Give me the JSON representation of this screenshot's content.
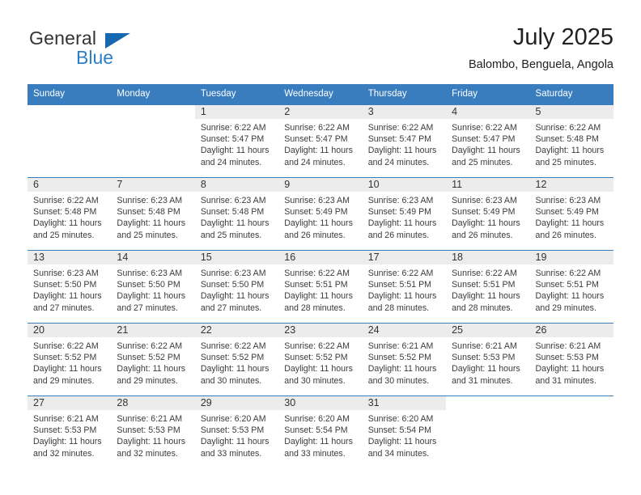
{
  "brand": {
    "name_part1": "General",
    "name_part2": "Blue",
    "triangle_color": "#1668b3",
    "blue_color": "#2a7fc9"
  },
  "header": {
    "title": "July 2025",
    "subtitle": "Balombo, Benguela, Angola"
  },
  "colors": {
    "header_row": "#3a7dbf",
    "daynum_strip": "#ececec",
    "row_separator": "#3a7dbf",
    "text": "#3b3b3b"
  },
  "weekday_headers": [
    "Sunday",
    "Monday",
    "Tuesday",
    "Wednesday",
    "Thursday",
    "Friday",
    "Saturday"
  ],
  "weeks": [
    [
      {
        "day": "",
        "sunrise": "",
        "sunset": "",
        "daylight": ""
      },
      {
        "day": "",
        "sunrise": "",
        "sunset": "",
        "daylight": ""
      },
      {
        "day": "1",
        "sunrise": "Sunrise: 6:22 AM",
        "sunset": "Sunset: 5:47 PM",
        "daylight": "Daylight: 11 hours and 24 minutes."
      },
      {
        "day": "2",
        "sunrise": "Sunrise: 6:22 AM",
        "sunset": "Sunset: 5:47 PM",
        "daylight": "Daylight: 11 hours and 24 minutes."
      },
      {
        "day": "3",
        "sunrise": "Sunrise: 6:22 AM",
        "sunset": "Sunset: 5:47 PM",
        "daylight": "Daylight: 11 hours and 24 minutes."
      },
      {
        "day": "4",
        "sunrise": "Sunrise: 6:22 AM",
        "sunset": "Sunset: 5:47 PM",
        "daylight": "Daylight: 11 hours and 25 minutes."
      },
      {
        "day": "5",
        "sunrise": "Sunrise: 6:22 AM",
        "sunset": "Sunset: 5:48 PM",
        "daylight": "Daylight: 11 hours and 25 minutes."
      }
    ],
    [
      {
        "day": "6",
        "sunrise": "Sunrise: 6:22 AM",
        "sunset": "Sunset: 5:48 PM",
        "daylight": "Daylight: 11 hours and 25 minutes."
      },
      {
        "day": "7",
        "sunrise": "Sunrise: 6:23 AM",
        "sunset": "Sunset: 5:48 PM",
        "daylight": "Daylight: 11 hours and 25 minutes."
      },
      {
        "day": "8",
        "sunrise": "Sunrise: 6:23 AM",
        "sunset": "Sunset: 5:48 PM",
        "daylight": "Daylight: 11 hours and 25 minutes."
      },
      {
        "day": "9",
        "sunrise": "Sunrise: 6:23 AM",
        "sunset": "Sunset: 5:49 PM",
        "daylight": "Daylight: 11 hours and 26 minutes."
      },
      {
        "day": "10",
        "sunrise": "Sunrise: 6:23 AM",
        "sunset": "Sunset: 5:49 PM",
        "daylight": "Daylight: 11 hours and 26 minutes."
      },
      {
        "day": "11",
        "sunrise": "Sunrise: 6:23 AM",
        "sunset": "Sunset: 5:49 PM",
        "daylight": "Daylight: 11 hours and 26 minutes."
      },
      {
        "day": "12",
        "sunrise": "Sunrise: 6:23 AM",
        "sunset": "Sunset: 5:49 PM",
        "daylight": "Daylight: 11 hours and 26 minutes."
      }
    ],
    [
      {
        "day": "13",
        "sunrise": "Sunrise: 6:23 AM",
        "sunset": "Sunset: 5:50 PM",
        "daylight": "Daylight: 11 hours and 27 minutes."
      },
      {
        "day": "14",
        "sunrise": "Sunrise: 6:23 AM",
        "sunset": "Sunset: 5:50 PM",
        "daylight": "Daylight: 11 hours and 27 minutes."
      },
      {
        "day": "15",
        "sunrise": "Sunrise: 6:23 AM",
        "sunset": "Sunset: 5:50 PM",
        "daylight": "Daylight: 11 hours and 27 minutes."
      },
      {
        "day": "16",
        "sunrise": "Sunrise: 6:22 AM",
        "sunset": "Sunset: 5:51 PM",
        "daylight": "Daylight: 11 hours and 28 minutes."
      },
      {
        "day": "17",
        "sunrise": "Sunrise: 6:22 AM",
        "sunset": "Sunset: 5:51 PM",
        "daylight": "Daylight: 11 hours and 28 minutes."
      },
      {
        "day": "18",
        "sunrise": "Sunrise: 6:22 AM",
        "sunset": "Sunset: 5:51 PM",
        "daylight": "Daylight: 11 hours and 28 minutes."
      },
      {
        "day": "19",
        "sunrise": "Sunrise: 6:22 AM",
        "sunset": "Sunset: 5:51 PM",
        "daylight": "Daylight: 11 hours and 29 minutes."
      }
    ],
    [
      {
        "day": "20",
        "sunrise": "Sunrise: 6:22 AM",
        "sunset": "Sunset: 5:52 PM",
        "daylight": "Daylight: 11 hours and 29 minutes."
      },
      {
        "day": "21",
        "sunrise": "Sunrise: 6:22 AM",
        "sunset": "Sunset: 5:52 PM",
        "daylight": "Daylight: 11 hours and 29 minutes."
      },
      {
        "day": "22",
        "sunrise": "Sunrise: 6:22 AM",
        "sunset": "Sunset: 5:52 PM",
        "daylight": "Daylight: 11 hours and 30 minutes."
      },
      {
        "day": "23",
        "sunrise": "Sunrise: 6:22 AM",
        "sunset": "Sunset: 5:52 PM",
        "daylight": "Daylight: 11 hours and 30 minutes."
      },
      {
        "day": "24",
        "sunrise": "Sunrise: 6:21 AM",
        "sunset": "Sunset: 5:52 PM",
        "daylight": "Daylight: 11 hours and 30 minutes."
      },
      {
        "day": "25",
        "sunrise": "Sunrise: 6:21 AM",
        "sunset": "Sunset: 5:53 PM",
        "daylight": "Daylight: 11 hours and 31 minutes."
      },
      {
        "day": "26",
        "sunrise": "Sunrise: 6:21 AM",
        "sunset": "Sunset: 5:53 PM",
        "daylight": "Daylight: 11 hours and 31 minutes."
      }
    ],
    [
      {
        "day": "27",
        "sunrise": "Sunrise: 6:21 AM",
        "sunset": "Sunset: 5:53 PM",
        "daylight": "Daylight: 11 hours and 32 minutes."
      },
      {
        "day": "28",
        "sunrise": "Sunrise: 6:21 AM",
        "sunset": "Sunset: 5:53 PM",
        "daylight": "Daylight: 11 hours and 32 minutes."
      },
      {
        "day": "29",
        "sunrise": "Sunrise: 6:20 AM",
        "sunset": "Sunset: 5:53 PM",
        "daylight": "Daylight: 11 hours and 33 minutes."
      },
      {
        "day": "30",
        "sunrise": "Sunrise: 6:20 AM",
        "sunset": "Sunset: 5:54 PM",
        "daylight": "Daylight: 11 hours and 33 minutes."
      },
      {
        "day": "31",
        "sunrise": "Sunrise: 6:20 AM",
        "sunset": "Sunset: 5:54 PM",
        "daylight": "Daylight: 11 hours and 34 minutes."
      },
      {
        "day": "",
        "sunrise": "",
        "sunset": "",
        "daylight": ""
      },
      {
        "day": "",
        "sunrise": "",
        "sunset": "",
        "daylight": ""
      }
    ]
  ]
}
